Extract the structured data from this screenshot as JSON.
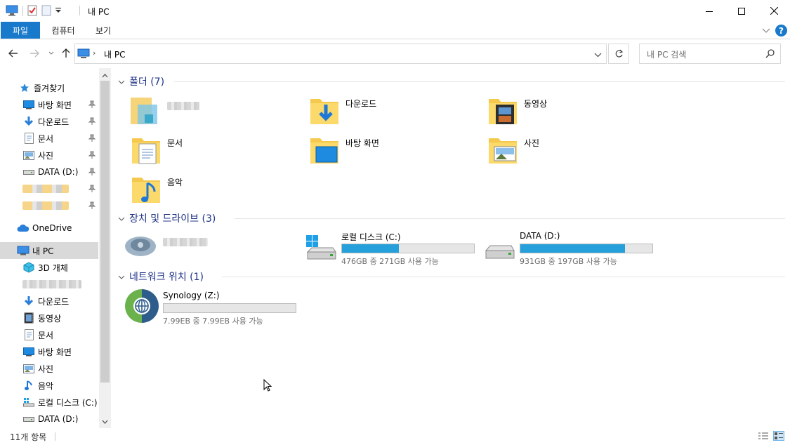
{
  "window": {
    "title": "내 PC",
    "quick_access_toolbar": [
      "pc-icon",
      "properties-icon",
      "new-folder-icon",
      "customize-dropdown"
    ],
    "controls": [
      "minimize-icon",
      "maximize-icon",
      "close-icon"
    ]
  },
  "ribbon": {
    "tabs": [
      {
        "label": "파일",
        "active": true
      },
      {
        "label": "컴퓨터",
        "active": false
      },
      {
        "label": "보기",
        "active": false
      }
    ],
    "accent_color": "#1979ca"
  },
  "nav": {
    "breadcrumb": [
      "내 PC"
    ],
    "search_placeholder": "내 PC 검색"
  },
  "sidebar": {
    "quick_access": {
      "label": "즐겨찾기",
      "items": [
        {
          "label": "바탕 화면",
          "icon": "desktop-icon",
          "pinned": true
        },
        {
          "label": "다운로드",
          "icon": "download-icon",
          "pinned": true
        },
        {
          "label": "문서",
          "icon": "document-icon",
          "pinned": true
        },
        {
          "label": "사진",
          "icon": "picture-icon",
          "pinned": true
        },
        {
          "label": "DATA (D:)",
          "icon": "drive-icon",
          "pinned": true
        }
      ]
    },
    "onedrive_label": "OneDrive",
    "this_pc": {
      "label": "내 PC",
      "items": [
        {
          "label": "3D 개체",
          "icon": "3d-objects-icon"
        },
        {
          "label": "다운로드",
          "icon": "download-icon"
        },
        {
          "label": "동영상",
          "icon": "video-icon"
        },
        {
          "label": "문서",
          "icon": "document-icon"
        },
        {
          "label": "바탕 화면",
          "icon": "desktop-icon"
        },
        {
          "label": "사진",
          "icon": "picture-icon"
        },
        {
          "label": "음악",
          "icon": "music-icon"
        },
        {
          "label": "로컬 디스크 (C:)",
          "icon": "windows-drive-icon"
        },
        {
          "label": "DATA (D:)",
          "icon": "drive-icon"
        }
      ]
    }
  },
  "main": {
    "folders_header": "폴더 (7)",
    "folders": [
      {
        "label": "다운로드",
        "icon": "download-folder-icon"
      },
      {
        "label": "동영상",
        "icon": "video-folder-icon"
      },
      {
        "label": "문서",
        "icon": "document-folder-icon"
      },
      {
        "label": "바탕 화면",
        "icon": "desktop-folder-icon"
      },
      {
        "label": "사진",
        "icon": "picture-folder-icon"
      },
      {
        "label": "음악",
        "icon": "music-folder-icon"
      }
    ],
    "devices_header": "장치 및 드라이브 (3)",
    "drives": [
      {
        "name": "로컬 디스크 (C:)",
        "subtitle": "476GB 중 271GB 사용 가능",
        "used_fraction": 0.43,
        "icon": "windows-drive-icon"
      },
      {
        "name": "DATA (D:)",
        "subtitle": "931GB 중 197GB 사용 가능",
        "used_fraction": 0.79,
        "icon": "drive-icon"
      }
    ],
    "network_header": "네트워크 위치 (1)",
    "network": [
      {
        "name": "Synology (Z:)",
        "subtitle": "7.99EB 중 7.99EB 사용 가능",
        "used_fraction": 0.0,
        "icon": "network-drive-icon"
      }
    ]
  },
  "status": {
    "item_count": "11개 항목"
  },
  "colors": {
    "bar_fill": "#26a0da",
    "header_text": "#1e3287",
    "selection": "#d9d9d9"
  }
}
